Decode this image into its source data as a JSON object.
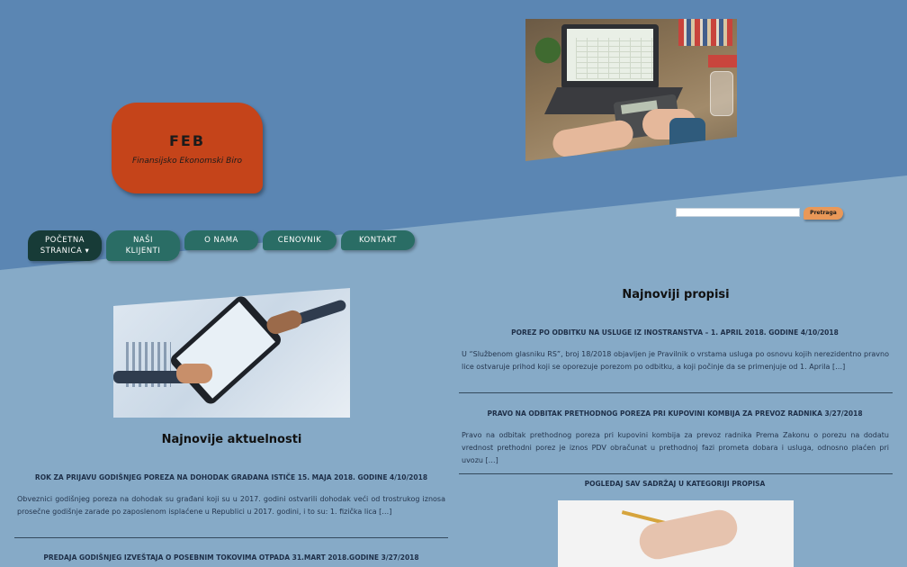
{
  "logo": {
    "title": "FEB",
    "subtitle": "Finansijsko Ekonomski Biro"
  },
  "search": {
    "placeholder": "",
    "button_label": "Pretraga"
  },
  "nav": [
    {
      "line1": "POČETNA",
      "line2": "STRANICA ▾"
    },
    {
      "line1": "NAŠI",
      "line2": "KLIJENTI"
    },
    {
      "line1": "O NAMA",
      "line2": ""
    },
    {
      "line1": "CENOVNIK",
      "line2": ""
    },
    {
      "line1": "KONTAKT",
      "line2": ""
    }
  ],
  "left": {
    "section_title": "Najnovije aktuelnosti",
    "articles": [
      {
        "title": "ROK ZA PRIJAVU GODIŠNJEG POREZA NA DOHODAK GRAĐANA ISTIČE 15. MAJA 2018. GODINE 4/10/2018",
        "text": "Obveznici godišnjeg poreza na dohodak su građani koji su u 2017. godini ostvarili dohodak veći od trostrukog iznosa prosečne godišnje zarade po zaposlenom isplaćene u Republici u 2017. godini, i to su: 1. fizička lica […]"
      },
      {
        "title": "PREDAJA GODIŠNJEG IZVEŠTAJA O POSEBNIM TOKOVIMA OTPADA 31.MART 2018.GODINE 3/27/2018",
        "text": ""
      }
    ]
  },
  "right": {
    "section_title": "Najnoviji propisi",
    "articles": [
      {
        "title": "POREZ PO ODBITKU NA USLUGE IZ INOSTRANSTVA – 1. APRIL 2018. GODINE 4/10/2018",
        "text": "U “Službenom glasniku RS”, broj 18/2018 objavljen je Pravilnik o vrstama usluga po osnovu kojih nerezidentno pravno lice ostvaruje prihod koji se oporezuje porezom po odbitku, a koji počinje da se primenjuje od 1. Aprila […]"
      },
      {
        "title": "PRAVO NA ODBITAK PRETHODNOG POREZA PRI KUPOVINI KOMBIJA ZA PREVOZ RADNIKA 3/27/2018",
        "text": "Pravo na odbitak prethodnog poreza pri kupovini kombija za prevoz radnika Prema Zakonu o porezu na dodatu vrednost prethodni porez je iznos PDV obračunat u prethodnoj fazi prometa dobara i usluga, odnosno plaćen pri uvozu […]"
      }
    ],
    "view_all": "POGLEDAJ SAV SADRŽAJ U KATEGORIJI PROPISA"
  }
}
